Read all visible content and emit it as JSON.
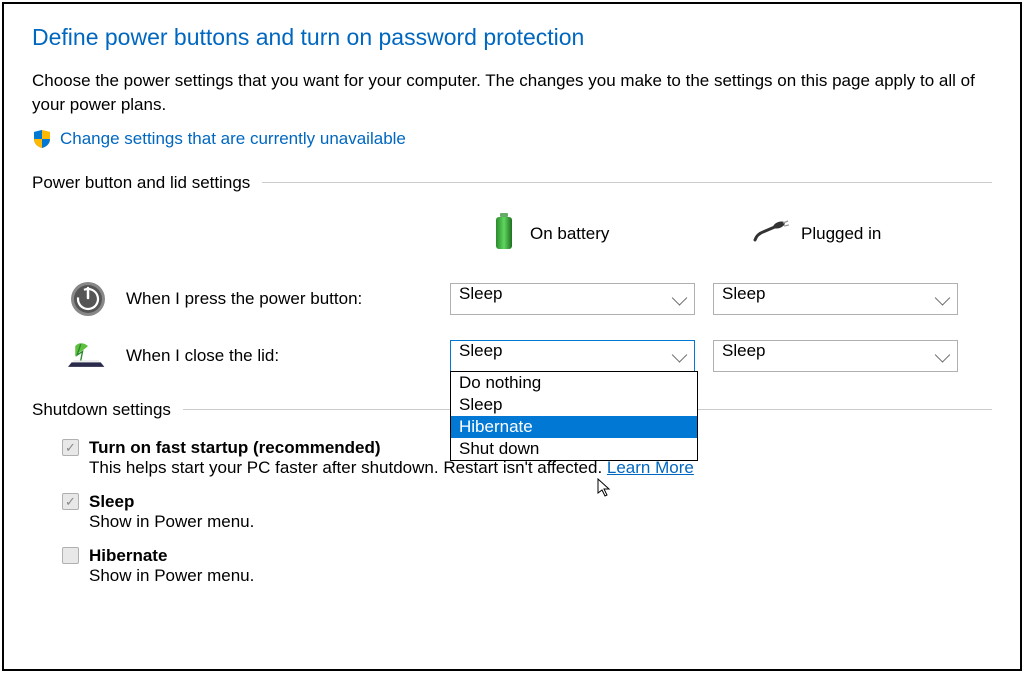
{
  "title": "Define power buttons and turn on password protection",
  "description": "Choose the power settings that you want for your computer. The changes you make to the settings on this page apply to all of your power plans.",
  "change_link": "Change settings that are currently unavailable",
  "section1_title": "Power button and lid settings",
  "columns": {
    "battery": "On battery",
    "plugged": "Plugged in"
  },
  "rows": {
    "power_button": {
      "label": "When I press the power button:",
      "battery_value": "Sleep",
      "plugged_value": "Sleep"
    },
    "close_lid": {
      "label": "When I close the lid:",
      "battery_value": "Sleep",
      "plugged_value": "Sleep"
    }
  },
  "dropdown_options": [
    "Do nothing",
    "Sleep",
    "Hibernate",
    "Shut down"
  ],
  "dropdown_highlighted": "Hibernate",
  "section2_title": "Shutdown settings",
  "shutdown_items": [
    {
      "title": "Turn on fast startup (recommended)",
      "desc_prefix": "This helps start your PC faster after shutdown. Restart isn't affected. ",
      "learn_more": "Learn More",
      "checked": true
    },
    {
      "title": "Sleep",
      "desc": "Show in Power menu.",
      "checked": true
    },
    {
      "title": "Hibernate",
      "desc": "Show in Power menu.",
      "checked": false
    }
  ]
}
